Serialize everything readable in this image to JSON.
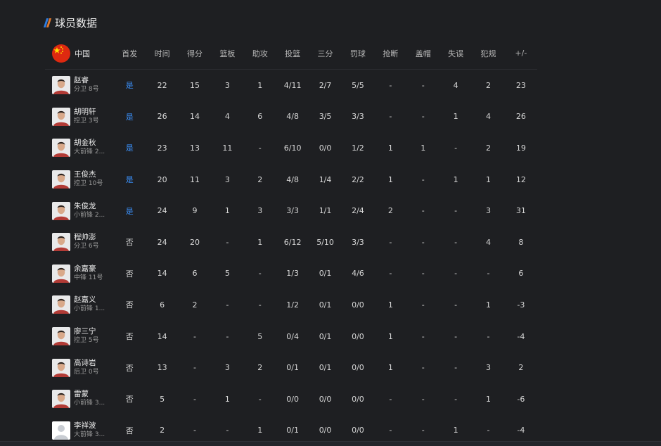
{
  "section": {
    "title": "球员数据",
    "bar_colors": [
      "#2f7de1",
      "#e0782c"
    ]
  },
  "team": {
    "name": "中国",
    "flag_icon": "china-flag-icon"
  },
  "columns": [
    "首发",
    "时间",
    "得分",
    "篮板",
    "助攻",
    "投篮",
    "三分",
    "罚球",
    "抢断",
    "盖帽",
    "失误",
    "犯规",
    "+/-"
  ],
  "starter_color": "#3a8ef6",
  "players": [
    {
      "name": "赵睿",
      "position": "分卫 8号",
      "avatar": "player-photo-icon",
      "starter": "是",
      "is_starter": true,
      "min": "22",
      "pts": "15",
      "reb": "3",
      "ast": "1",
      "fg": "4/11",
      "tp": "2/7",
      "ft": "5/5",
      "stl": "-",
      "blk": "-",
      "tov": "4",
      "pf": "2",
      "pm": "23"
    },
    {
      "name": "胡明轩",
      "position": "控卫 3号",
      "avatar": "player-photo-icon",
      "starter": "是",
      "is_starter": true,
      "min": "26",
      "pts": "14",
      "reb": "4",
      "ast": "6",
      "fg": "4/8",
      "tp": "3/5",
      "ft": "3/3",
      "stl": "-",
      "blk": "-",
      "tov": "1",
      "pf": "4",
      "pm": "26"
    },
    {
      "name": "胡金秋",
      "position": "大前锋 2...",
      "avatar": "player-photo-icon",
      "starter": "是",
      "is_starter": true,
      "min": "23",
      "pts": "13",
      "reb": "11",
      "ast": "-",
      "fg": "6/10",
      "tp": "0/0",
      "ft": "1/2",
      "stl": "1",
      "blk": "1",
      "tov": "-",
      "pf": "2",
      "pm": "19"
    },
    {
      "name": "王俊杰",
      "position": "控卫 10号",
      "avatar": "player-photo-icon",
      "starter": "是",
      "is_starter": true,
      "min": "20",
      "pts": "11",
      "reb": "3",
      "ast": "2",
      "fg": "4/8",
      "tp": "1/4",
      "ft": "2/2",
      "stl": "1",
      "blk": "-",
      "tov": "1",
      "pf": "1",
      "pm": "12"
    },
    {
      "name": "朱俊龙",
      "position": "小前锋 2...",
      "avatar": "player-photo-icon",
      "starter": "是",
      "is_starter": true,
      "min": "24",
      "pts": "9",
      "reb": "1",
      "ast": "3",
      "fg": "3/3",
      "tp": "1/1",
      "ft": "2/4",
      "stl": "2",
      "blk": "-",
      "tov": "-",
      "pf": "3",
      "pm": "31"
    },
    {
      "name": "程帅澎",
      "position": "分卫 6号",
      "avatar": "player-photo-icon",
      "starter": "否",
      "is_starter": false,
      "min": "24",
      "pts": "20",
      "reb": "-",
      "ast": "1",
      "fg": "6/12",
      "tp": "5/10",
      "ft": "3/3",
      "stl": "-",
      "blk": "-",
      "tov": "-",
      "pf": "4",
      "pm": "8"
    },
    {
      "name": "余嘉豪",
      "position": "中锋 11号",
      "avatar": "player-photo-icon",
      "starter": "否",
      "is_starter": false,
      "min": "14",
      "pts": "6",
      "reb": "5",
      "ast": "-",
      "fg": "1/3",
      "tp": "0/1",
      "ft": "4/6",
      "stl": "-",
      "blk": "-",
      "tov": "-",
      "pf": "-",
      "pm": "6"
    },
    {
      "name": "赵嘉义",
      "position": "小前锋 1...",
      "avatar": "player-photo-icon",
      "starter": "否",
      "is_starter": false,
      "min": "6",
      "pts": "2",
      "reb": "-",
      "ast": "-",
      "fg": "1/2",
      "tp": "0/1",
      "ft": "0/0",
      "stl": "1",
      "blk": "-",
      "tov": "-",
      "pf": "1",
      "pm": "-3"
    },
    {
      "name": "廖三宁",
      "position": "控卫 5号",
      "avatar": "player-photo-icon",
      "starter": "否",
      "is_starter": false,
      "min": "14",
      "pts": "-",
      "reb": "-",
      "ast": "5",
      "fg": "0/4",
      "tp": "0/1",
      "ft": "0/0",
      "stl": "1",
      "blk": "-",
      "tov": "-",
      "pf": "-",
      "pm": "-4"
    },
    {
      "name": "高诗岩",
      "position": "后卫 0号",
      "avatar": "player-photo-icon",
      "starter": "否",
      "is_starter": false,
      "min": "13",
      "pts": "-",
      "reb": "3",
      "ast": "2",
      "fg": "0/1",
      "tp": "0/1",
      "ft": "0/0",
      "stl": "1",
      "blk": "-",
      "tov": "-",
      "pf": "3",
      "pm": "2"
    },
    {
      "name": "雷蒙",
      "position": "小前锋 3...",
      "avatar": "player-photo-icon",
      "starter": "否",
      "is_starter": false,
      "min": "5",
      "pts": "-",
      "reb": "1",
      "ast": "-",
      "fg": "0/0",
      "tp": "0/0",
      "ft": "0/0",
      "stl": "-",
      "blk": "-",
      "tov": "-",
      "pf": "1",
      "pm": "-6"
    },
    {
      "name": "李祥波",
      "position": "大前锋 3...",
      "avatar": "default-avatar-icon",
      "starter": "否",
      "is_starter": false,
      "min": "2",
      "pts": "-",
      "reb": "-",
      "ast": "1",
      "fg": "0/1",
      "tp": "0/0",
      "ft": "0/0",
      "stl": "-",
      "blk": "-",
      "tov": "1",
      "pf": "-",
      "pm": "-4"
    }
  ]
}
